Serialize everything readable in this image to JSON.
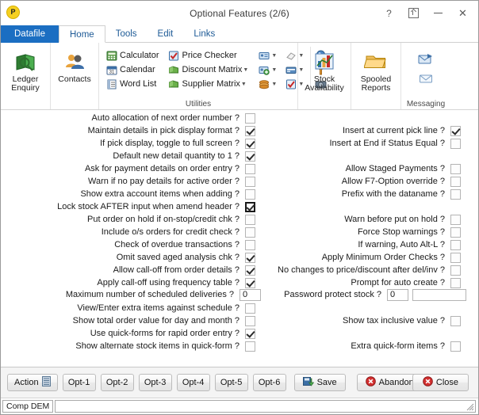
{
  "window": {
    "title": "Optional Features (2/6)",
    "logo_letter": "P",
    "controls": [
      {
        "name": "help-button",
        "glyph": "?"
      },
      {
        "name": "restore-button",
        "glyph": ""
      },
      {
        "name": "minimize-button",
        "glyph": "–"
      },
      {
        "name": "close-button",
        "glyph": "✕"
      }
    ]
  },
  "tabs": [
    {
      "label": "Datafile",
      "kind": "datafile"
    },
    {
      "label": "Home",
      "kind": "active"
    },
    {
      "label": "Tools",
      "kind": "normal"
    },
    {
      "label": "Edit",
      "kind": "normal"
    },
    {
      "label": "Links",
      "kind": "normal"
    }
  ],
  "ribbon": {
    "big_buttons": [
      {
        "label_line1": "Ledger",
        "label_line2": "Enquiry",
        "icon": "ledger-enquiry-icon"
      },
      {
        "label_line1": "Contacts",
        "label_line2": "",
        "icon": "contacts-icon"
      }
    ],
    "utilities": {
      "group_title": "Utilities",
      "column1": [
        {
          "label": "Calculator",
          "icon": "calculator-icon",
          "caret": false
        },
        {
          "label": "Calendar",
          "icon": "calendar-icon",
          "caret": false
        },
        {
          "label": "Word List",
          "icon": "word-list-icon",
          "caret": false
        }
      ],
      "column2": [
        {
          "label": "Price Checker",
          "icon": "price-checker-icon",
          "caret": false
        },
        {
          "label": "Discount Matrix",
          "icon": "discount-matrix-icon",
          "caret": true
        },
        {
          "label": "Supplier Matrix",
          "icon": "supplier-matrix-icon",
          "caret": true
        }
      ],
      "column3": [
        {
          "icon": "contact-card-icon",
          "caret": true
        },
        {
          "icon": "add-contact-icon",
          "caret": true
        },
        {
          "icon": "stack-icon",
          "caret": true
        }
      ],
      "column4": [
        {
          "icon": "eraser-icon",
          "caret": true
        },
        {
          "icon": "card-payment-icon",
          "caret": true
        },
        {
          "icon": "checklist-icon",
          "caret": true
        }
      ],
      "column5": [
        {
          "icon": "paint-icon",
          "caret": false
        },
        {
          "icon": "key-icon",
          "caret": false
        },
        {
          "icon": "camera-icon",
          "caret": false
        }
      ]
    },
    "stock_availability": {
      "label_line1": "Stock",
      "label_line2": "Availability",
      "icon": "stock-chart-icon"
    },
    "spooled_reports": {
      "label_line1": "Spooled",
      "label_line2": "Reports",
      "icon": "folder-icon"
    },
    "messaging": {
      "group_title": "Messaging",
      "icons": [
        {
          "icon": "send-mail-icon"
        },
        {
          "icon": "open-mail-icon"
        }
      ]
    }
  },
  "form": {
    "left_column": [
      {
        "label": "Auto allocation of next order number ?",
        "type": "checkbox",
        "checked": false,
        "focused": false
      },
      {
        "label": "Maintain details in pick display format ?",
        "type": "checkbox",
        "checked": true,
        "focused": false
      },
      {
        "label": "If pick display, toggle to full screen ?",
        "type": "checkbox",
        "checked": true,
        "focused": false
      },
      {
        "label": "Default new detail quantity to 1 ?",
        "type": "checkbox",
        "checked": true,
        "focused": false
      },
      {
        "label": "Ask for payment details on order entry ?",
        "type": "checkbox",
        "checked": false,
        "focused": false
      },
      {
        "label": "Warn if no pay details for active order ?",
        "type": "checkbox",
        "checked": false,
        "focused": false
      },
      {
        "label": "Show extra account items when adding ?",
        "type": "checkbox",
        "checked": false,
        "focused": false
      },
      {
        "label": "Lock stock AFTER input when amend header ?",
        "type": "checkbox",
        "checked": true,
        "focused": true
      },
      {
        "label": "Put order on hold if on-stop/credit chk ?",
        "type": "checkbox",
        "checked": false,
        "focused": false
      },
      {
        "label": "Include o/s orders for credit check ?",
        "type": "checkbox",
        "checked": false,
        "focused": false
      },
      {
        "label": "Check of overdue transactions ?",
        "type": "checkbox",
        "checked": false,
        "focused": false
      },
      {
        "label": "Omit saved aged analysis chk ?",
        "type": "checkbox",
        "checked": true,
        "focused": false
      },
      {
        "label": "Allow call-off from order details ?",
        "type": "checkbox",
        "checked": true,
        "focused": false
      },
      {
        "label": "Apply call-off using frequency table ?",
        "type": "checkbox",
        "checked": true,
        "focused": false
      },
      {
        "label": "Maximum number of scheduled deliveries ?",
        "type": "text",
        "value": "0"
      },
      {
        "label": "View/Enter extra items against schedule ?",
        "type": "checkbox",
        "checked": false,
        "focused": false
      },
      {
        "label": "Show total order value for day and month ?",
        "type": "checkbox",
        "checked": false,
        "focused": false
      },
      {
        "label": "Use quick-forms for rapid order entry ?",
        "type": "checkbox",
        "checked": true,
        "focused": false
      },
      {
        "label": "Show alternate stock items in quick-form ?",
        "type": "checkbox",
        "checked": false,
        "focused": false
      }
    ],
    "right_column": [
      {
        "row": 1,
        "label": "Insert at current pick line ?",
        "type": "checkbox",
        "checked": true
      },
      {
        "row": 2,
        "label": "Insert at End if Status Equal ?",
        "type": "checkbox",
        "checked": false
      },
      {
        "row": 4,
        "label": "Allow Staged Payments ?",
        "type": "checkbox",
        "checked": false
      },
      {
        "row": 5,
        "label": "Allow F7-Option override ?",
        "type": "checkbox",
        "checked": false
      },
      {
        "row": 6,
        "label": "Prefix with the dataname ?",
        "type": "checkbox",
        "checked": false
      },
      {
        "row": 8,
        "label": "Warn before put on hold ?",
        "type": "checkbox",
        "checked": false
      },
      {
        "row": 9,
        "label": "Force Stop warnings ?",
        "type": "checkbox",
        "checked": false
      },
      {
        "row": 10,
        "label": "If warning, Auto Alt-L ?",
        "type": "checkbox",
        "checked": false
      },
      {
        "row": 11,
        "label": "Apply Minimum Order Checks ?",
        "type": "checkbox",
        "checked": false
      },
      {
        "row": 12,
        "label": "No changes to price/discount after del/inv ?",
        "type": "checkbox",
        "checked": false
      },
      {
        "row": 13,
        "label": "Prompt for auto create ?",
        "type": "checkbox",
        "checked": false
      },
      {
        "row": 14,
        "label": "Password protect stock ?",
        "type": "text2",
        "value": "0",
        "value2": ""
      },
      {
        "row": 16,
        "label": "Show tax inclusive value ?",
        "type": "checkbox",
        "checked": false
      },
      {
        "row": 18,
        "label": "Extra quick-form items ?",
        "type": "checkbox",
        "checked": false
      }
    ]
  },
  "buttonbar": [
    {
      "name": "action-button",
      "label": "Action",
      "icon": "list-icon"
    },
    {
      "name": "opt1-button",
      "label": "Opt-1",
      "accel": "O"
    },
    {
      "name": "opt2-button",
      "label": "Opt-2",
      "accel": "O"
    },
    {
      "name": "opt3-button",
      "label": "Opt-3",
      "accel": "O"
    },
    {
      "name": "opt4-button",
      "label": "Opt-4",
      "accel": "O"
    },
    {
      "name": "opt5-button",
      "label": "Opt-5",
      "accel": "O"
    },
    {
      "name": "opt6-button",
      "label": "Opt-6",
      "accel": "O"
    },
    {
      "name": "save-button",
      "label": "Save",
      "icon": "save-icon"
    },
    {
      "name": "abandon-button",
      "label": "Abandon",
      "icon": "abandon-icon"
    }
  ],
  "close_button": {
    "label": "Close",
    "icon": "close-circle-icon"
  },
  "statusbar": {
    "company": "Comp DEM",
    "message": ""
  },
  "colors": {
    "datafile_tab": "#1b6ec2",
    "tab_text": "#1d5a96",
    "accent_red": "#cc2222",
    "accent_green": "#4a9b2a"
  }
}
